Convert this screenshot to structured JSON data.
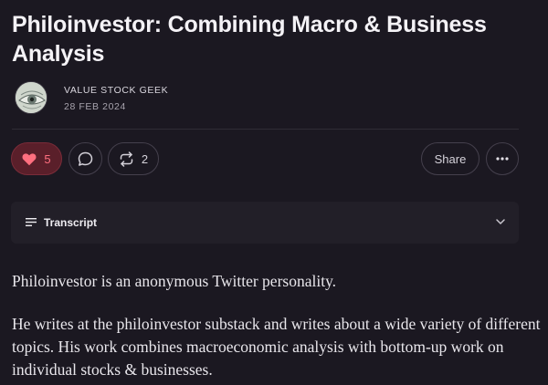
{
  "post": {
    "title": "Philoinvestor: Combining Macro & Business Analysis",
    "author": "VALUE STOCK GEEK",
    "date": "28 FEB 2024"
  },
  "actions": {
    "like_count": "5",
    "restack_count": "2",
    "share_label": "Share"
  },
  "transcript": {
    "label": "Transcript"
  },
  "body": {
    "paragraphs": [
      "Philoinvestor is an anonymous Twitter personality.",
      "He writes at the philoinvestor substack and writes about a wide variety of different topics. His work combines macroeconomic analysis with bottom-up work on individual stocks & businesses."
    ]
  },
  "icons": {
    "like": "heart-icon",
    "comment": "comment-bubble-icon",
    "restack": "restack-icon",
    "more": "ellipsis-icon",
    "transcript": "lines-icon",
    "expand": "chevron-down-icon"
  },
  "colors": {
    "background": "#1b1821",
    "like_accent": "#ff6f7f",
    "like_bg": "#5a1f2a"
  }
}
